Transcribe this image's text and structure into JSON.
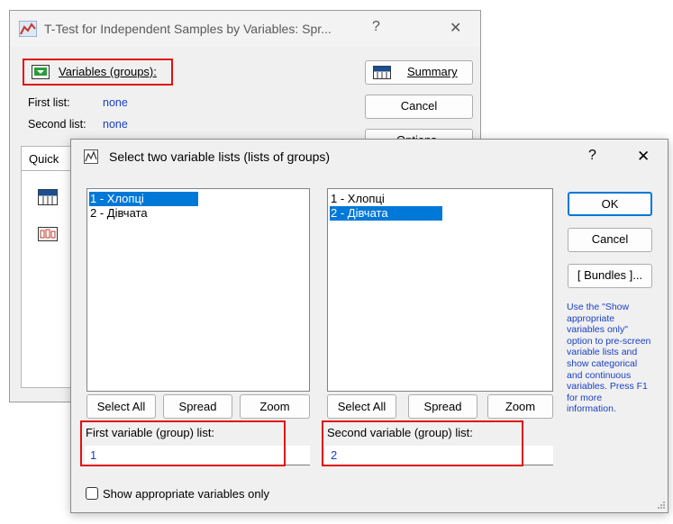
{
  "back_dialog": {
    "title": "T-Test for Independent Samples by Variables: Spr...",
    "help_symbol": "?",
    "close_symbol": "✕",
    "variables_button": "Variables (groups):",
    "first_list_label": "First list:",
    "first_list_value": "none",
    "second_list_label": "Second list:",
    "second_list_value": "none",
    "summary_button": "Summary",
    "cancel_button": "Cancel",
    "options_button": "Options",
    "tab_quick": "Quick",
    "summary_icon_text": "SUMM"
  },
  "front_dialog": {
    "title": "Select two variable lists (lists of groups)",
    "help_symbol": "?",
    "close_symbol": "✕",
    "left_list": {
      "items": [
        "1 - Хлопці",
        "2 - Дівчата"
      ],
      "selected_index": 0
    },
    "right_list": {
      "items": [
        "1 - Хлопці",
        "2 - Дівчата"
      ],
      "selected_index": 1
    },
    "left_buttons": {
      "select_all": "Select All",
      "spread": "Spread",
      "zoom": "Zoom"
    },
    "right_buttons": {
      "select_all": "Select All",
      "spread": "Spread",
      "zoom": "Zoom"
    },
    "first_field_label": "First variable (group) list:",
    "first_field_value": "1",
    "second_field_label": "Second variable (group) list:",
    "second_field_value": "2",
    "ok_button": "OK",
    "cancel_button": "Cancel",
    "bundles_button": "[ Bundles ]...",
    "help_text": "Use the \"Show appropriate variables only\" option to pre-screen variable lists and show categorical and continuous variables. Press F1 for more information.",
    "checkbox_label": "Show appropriate variables only",
    "checkbox_checked": false
  },
  "colors": {
    "accent_red": "#e01010",
    "selection_blue": "#0078d7",
    "link_blue": "#1a3fc4"
  }
}
